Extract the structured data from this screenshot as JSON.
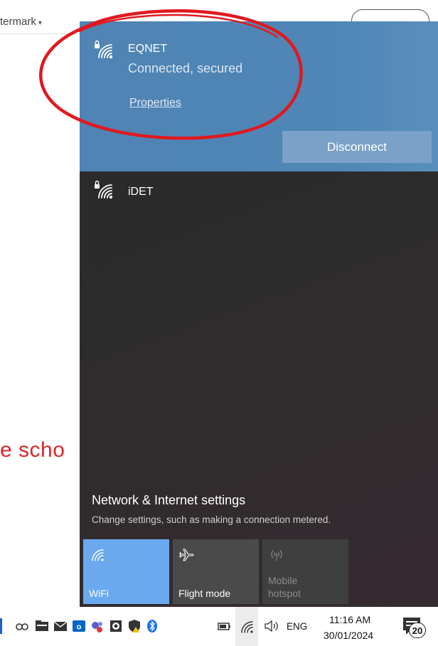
{
  "document": {
    "menu_label": "termark",
    "caret": "▾",
    "body_fragment": "e scho"
  },
  "flyout": {
    "connected_network": {
      "name": "EQNET",
      "status": "Connected, secured",
      "properties_link": "Properties",
      "disconnect_button": "Disconnect",
      "icon": "wifi-secured-icon"
    },
    "other_networks": [
      {
        "name": "iDET",
        "icon": "wifi-secured-icon"
      }
    ],
    "settings": {
      "title": "Network & Internet settings",
      "subtitle": "Change settings, such as making a connection metered."
    },
    "quick_actions": [
      {
        "label": "WiFi",
        "icon": "wifi-icon",
        "state": "on"
      },
      {
        "label": "Flight mode",
        "icon": "airplane-icon",
        "state": "off"
      },
      {
        "label": "Mobile hotspot",
        "icon": "hotspot-icon",
        "state": "disabled"
      }
    ]
  },
  "taskbar": {
    "time": "11:16 AM",
    "date": "30/01/2024",
    "language": "ENG",
    "notification_count": "20"
  },
  "colors": {
    "connected_bg": "#4f84b4",
    "disconnect_bg": "#7aa2c8",
    "wifi_tile": "#6aa9ed",
    "annotation": "#e0191f"
  }
}
